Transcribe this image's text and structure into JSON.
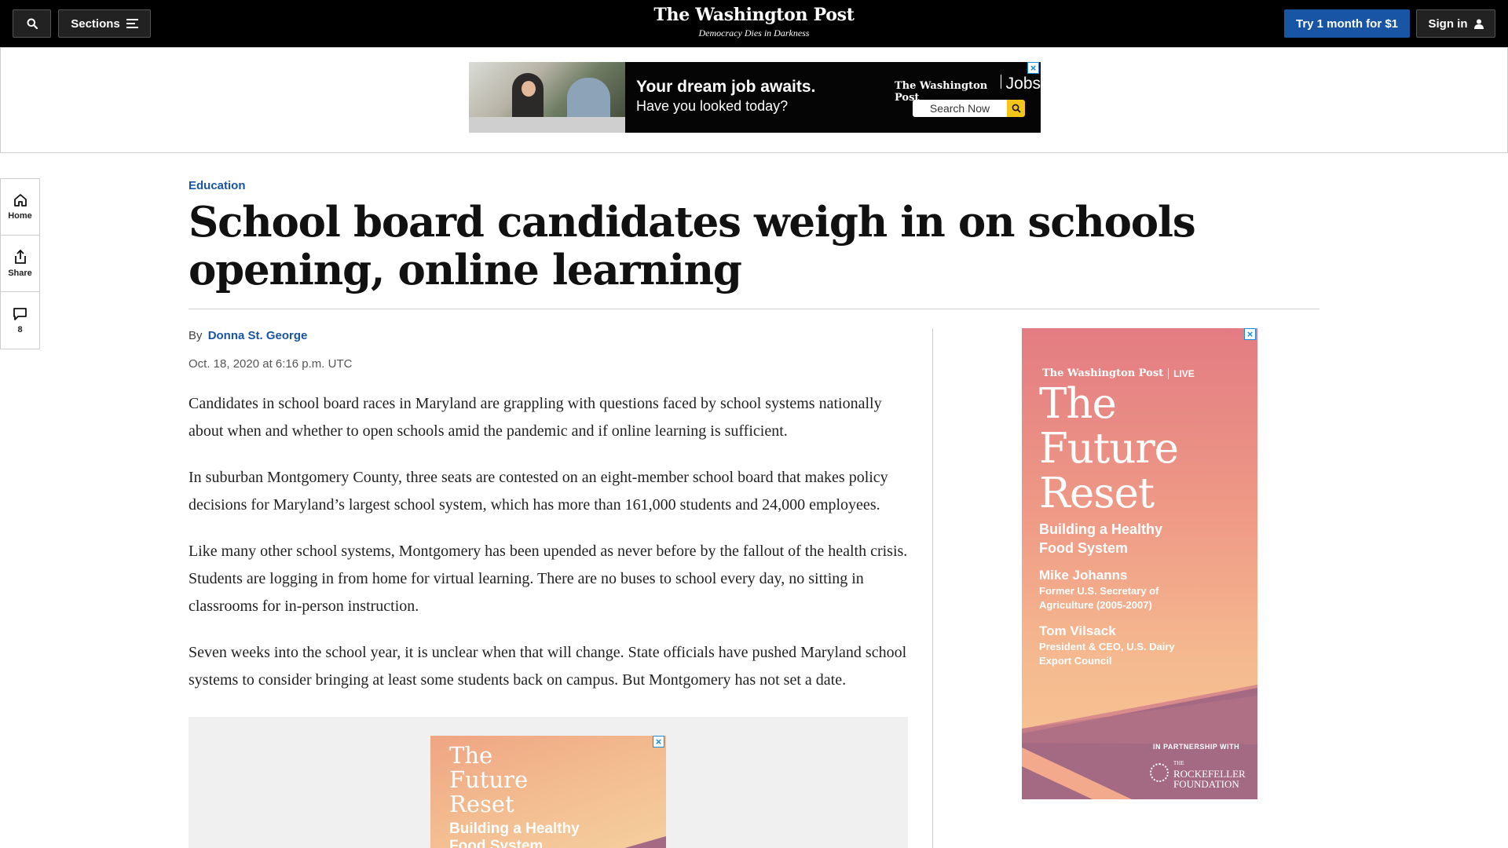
{
  "nav": {
    "sections_label": "Sections",
    "logo_name": "The Washington Post",
    "logo_tagline": "Democracy Dies in Darkness",
    "try_label": "Try 1 month for $1",
    "signin_label": "Sign in",
    "brand_color": "#1955a5"
  },
  "top_ad": {
    "headline": "Your dream job awaits.",
    "subline": "Have you looked today?",
    "logo_brand": "The Washington Post",
    "logo_suffix": "Jobs",
    "search_label": "Search Now",
    "close_label": "×"
  },
  "rail": {
    "home_label": "Home",
    "share_label": "Share",
    "comments_count": "8"
  },
  "article": {
    "kicker": "Education",
    "headline": "School board candidates weigh in on schools opening, online learning",
    "by_prefix": "By",
    "author": "Donna St. George",
    "date": "Oct. 18, 2020 at 6:16 p.m. UTC",
    "paragraphs": [
      "Candidates in school board races in Maryland are grappling with questions faced by school systems nationally about when and whether to open schools amid the pandemic and if online learning is sufficient.",
      "In suburban Montgomery County, three seats are contested on an eight-member school board that makes policy decisions for Maryland’s largest school system, which has more than 161,000 students and 24,000 employees.",
      "Like many other school systems, Montgomery has been upended as never before by the fallout of the health crisis. Students are logging in from home for virtual learning. There are no buses to school every day, no sitting in classrooms for in-person instruction.",
      "Seven weeks into the school year, it is unclear when that will change. State officials have pushed Maryland school systems to consider bringing at least some students back on campus. But Montgomery has not set a date."
    ]
  },
  "inline_ad": {
    "title": "The Future Reset",
    "subtitle": "Building a Healthy Food System",
    "close_label": "×"
  },
  "right_ad": {
    "brand": "The Washington Post",
    "brand_suffix": "LIVE",
    "title": "The Future Reset",
    "subtitle": "Building a Healthy Food System",
    "speaker1_name": "Mike Johanns",
    "speaker1_role": "Former U.S. Secretary of Agriculture (2005-2007)",
    "speaker2_name": "Tom Vilsack",
    "speaker2_role": "President & CEO, U.S. Dairy Export Council",
    "partner_label": "IN PARTNERSHIP WITH",
    "partner_the": "THE",
    "partner_name": "ROCKEFELLER FOUNDATION",
    "close_label": "×"
  }
}
